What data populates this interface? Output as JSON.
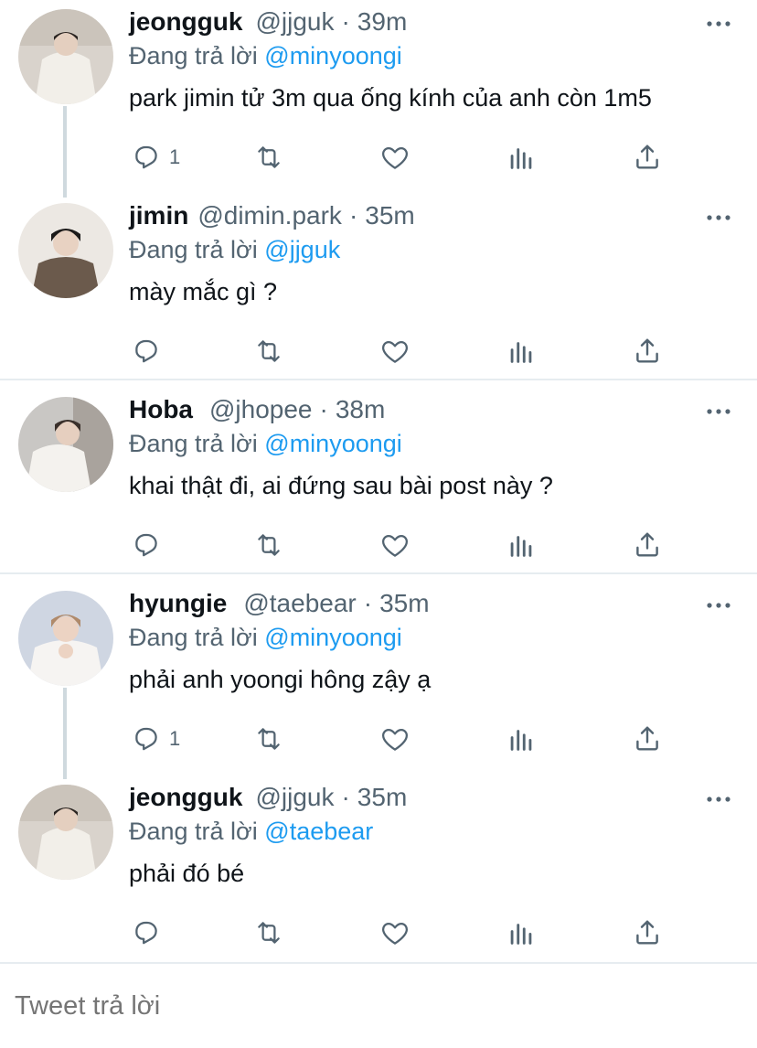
{
  "tweets": [
    {
      "name": "jeongguk",
      "handle": "@jjguk",
      "time": "39m",
      "reply_prefix": "Đang trả lời",
      "reply_to": "@minyoongi",
      "text": "park jimin tử 3m qua ống kính của anh còn 1m5",
      "reply_count": "1",
      "avatar": "white-outfit-avatar"
    },
    {
      "name": "jimin",
      "handle": "@dimin.park",
      "time": "35m",
      "reply_prefix": "Đang trả lời",
      "reply_to": "@jjguk",
      "text": "mày mắc gì ?",
      "reply_count": "",
      "avatar": "brown-sweater-avatar"
    },
    {
      "name": "Hoba",
      "handle": "@jhopee",
      "time": "38m",
      "reply_prefix": "Đang trả lời",
      "reply_to": "@minyoongi",
      "text": "khai thật đi, ai đứng sau bài post này ?",
      "reply_count": "",
      "avatar": "white-jacket-avatar"
    },
    {
      "name": "hyungie",
      "handle": "@taebear",
      "time": "35m",
      "reply_prefix": "Đang trả lời",
      "reply_to": "@minyoongi",
      "text": "phải anh yoongi hông zậy ạ",
      "reply_count": "1",
      "avatar": "lace-outfit-avatar"
    },
    {
      "name": "jeongguk",
      "handle": "@jjguk",
      "time": "35m",
      "reply_prefix": "Đang trả lời",
      "reply_to": "@taebear",
      "text": "phải đó bé",
      "reply_count": "",
      "avatar": "white-outfit-avatar"
    }
  ],
  "icons": {
    "reply": "comment-icon",
    "retweet": "retweet-icon",
    "like": "heart-icon",
    "views": "views-icon",
    "share": "share-icon",
    "more": "more-icon"
  },
  "compose": {
    "placeholder": "Tweet trả lời"
  },
  "colors": {
    "mention": "#1d9bf0",
    "secondary": "#536471",
    "text": "#0f1419",
    "divider": "#e6ecf0",
    "thread_line": "#cfd9de"
  }
}
